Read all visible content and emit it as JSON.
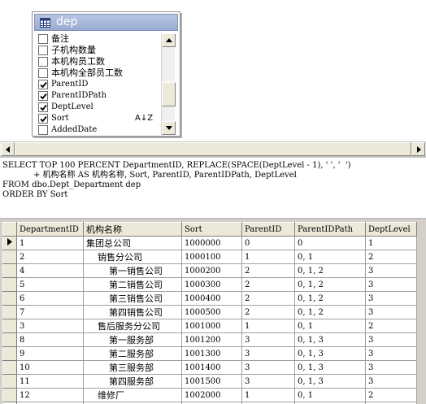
{
  "diagram": {
    "table_name": "dep",
    "fields": [
      {
        "name": "备注",
        "checked": false,
        "mono": false
      },
      {
        "name": "子机构数量",
        "checked": false,
        "mono": false
      },
      {
        "name": "本机构员工数",
        "checked": false,
        "mono": false
      },
      {
        "name": "本机构全部员工数",
        "checked": false,
        "mono": false
      },
      {
        "name": "ParentID",
        "checked": true,
        "mono": true
      },
      {
        "name": "ParentIDPath",
        "checked": true,
        "mono": true
      },
      {
        "name": "DeptLevel",
        "checked": true,
        "mono": true
      },
      {
        "name": "Sort",
        "checked": true,
        "mono": true,
        "sorted": true
      },
      {
        "name": "AddedDate",
        "checked": false,
        "mono": true
      }
    ],
    "sort_icon": "A↓Z"
  },
  "sql": {
    "line1": "SELECT TOP 100 PERCENT DepartmentID, REPLACE(SPACE(DeptLevel - 1), ' ', '  ')",
    "line2": "+ 机构名称 AS 机构名称, Sort, ParentID, ParentIDPath, DeptLevel",
    "line3": "FROM dbo.Dept_Department dep",
    "line4": "ORDER BY Sort"
  },
  "grid": {
    "columns": [
      "DepartmentID",
      "机构名称",
      "Sort",
      "ParentID",
      "ParentIDPath",
      "DeptLevel"
    ],
    "rows": [
      [
        "1",
        "集团总公司",
        "1000000",
        "0",
        "0",
        "1"
      ],
      [
        "2",
        "    销售分公司",
        "1000100",
        "1",
        "0, 1",
        "2"
      ],
      [
        "4",
        "        第一销售公司",
        "1000200",
        "2",
        "0, 1, 2",
        "3"
      ],
      [
        "5",
        "        第二销售公司",
        "1000300",
        "2",
        "0, 1, 2",
        "3"
      ],
      [
        "6",
        "        第三销售公司",
        "1000400",
        "2",
        "0, 1, 2",
        "3"
      ],
      [
        "7",
        "        第四销售公司",
        "1000500",
        "2",
        "0, 1, 2",
        "3"
      ],
      [
        "3",
        "    售后服务分公司",
        "1001000",
        "1",
        "0, 1",
        "2"
      ],
      [
        "8",
        "        第一服务部",
        "1001200",
        "3",
        "0, 1, 3",
        "3"
      ],
      [
        "9",
        "        第二服务部",
        "1001300",
        "3",
        "0, 1, 3",
        "3"
      ],
      [
        "10",
        "        第三服务部",
        "1001400",
        "3",
        "0, 1, 3",
        "3"
      ],
      [
        "11",
        "        第四服务部",
        "1001500",
        "3",
        "0, 1, 3",
        "3"
      ],
      [
        "12",
        "    维修厂",
        "1002000",
        "1",
        "0, 1",
        "2"
      ]
    ],
    "new_row_marker": "*"
  }
}
